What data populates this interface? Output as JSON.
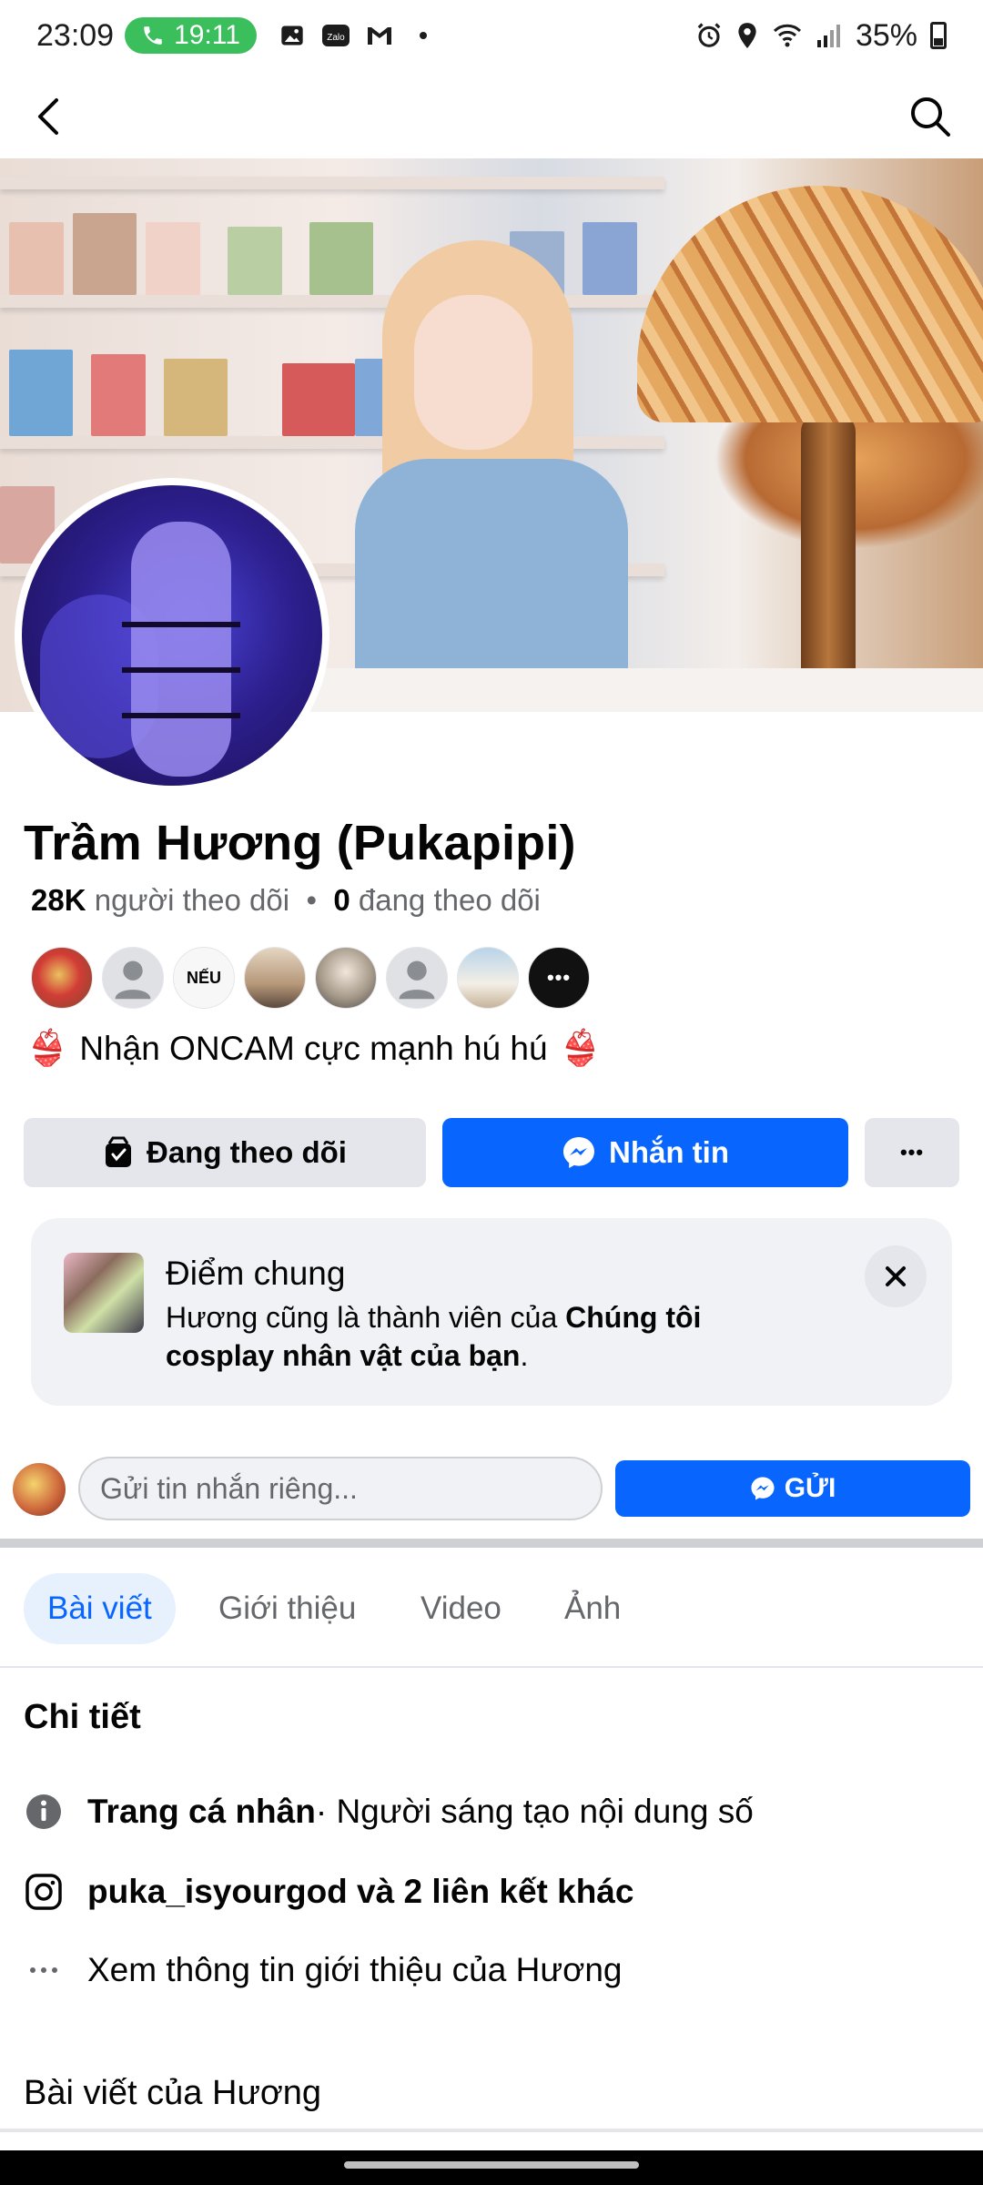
{
  "status_bar": {
    "time": "23:09",
    "call_timer": "19:11",
    "notification_icons": [
      "image-icon",
      "zalo-icon",
      "gmail-icon",
      "dot-icon"
    ],
    "zalo_label": "Zalo",
    "battery": "35%"
  },
  "profile": {
    "name": "Trầm Hương (Pukapipi)",
    "followers_count": "28K",
    "followers_label": "người theo dõi",
    "separator": "•",
    "following_count": "0",
    "following_label": "đang theo dõi",
    "friend_badge_text": "NẾU",
    "more_friends": "•••",
    "bio": "Nhận ONCAM cực mạnh hú hú",
    "bio_emoji_left": "👙",
    "bio_emoji_right": "👙"
  },
  "actions": {
    "following_label": "Đang theo dõi",
    "message_label": "Nhắn tin",
    "more_label": "•••"
  },
  "common_card": {
    "title": "Điểm chung",
    "text_prefix": "Hương cũng là thành viên của ",
    "group_name": "Chúng tôi cosplay nhân vật của bạn",
    "text_suffix": "."
  },
  "private_message": {
    "placeholder": "Gửi tin nhắn riêng...",
    "send_label": "GỬI"
  },
  "tabs": [
    {
      "label": "Bài viết",
      "active": true
    },
    {
      "label": "Giới thiệu",
      "active": false
    },
    {
      "label": "Video",
      "active": false
    },
    {
      "label": "Ảnh",
      "active": false
    }
  ],
  "details": {
    "title": "Chi tiết",
    "rows": [
      {
        "icon": "info-icon",
        "bold": "Trang cá nhân",
        "text": " · Người sáng tạo nội dung số"
      },
      {
        "icon": "instagram-icon",
        "bold": "puka_isyourgod và 2 liên kết khác",
        "text": ""
      },
      {
        "icon": "more-dots-icon",
        "bold": "",
        "text": "Xem thông tin giới thiệu của Hương"
      }
    ]
  },
  "posts_title": "Bài viết của Hương",
  "colors": {
    "accent": "#0866ff",
    "secondary_button": "#e4e6eb",
    "muted_text": "#65676b",
    "call_pill": "#3bbf5d"
  }
}
